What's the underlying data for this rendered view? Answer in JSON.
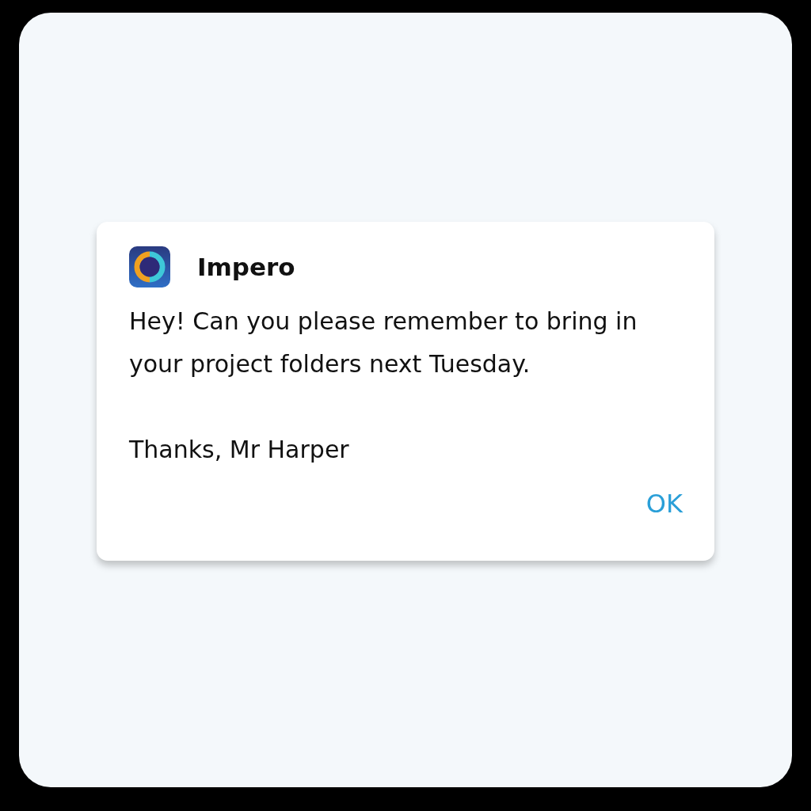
{
  "dialog": {
    "app_name": "Impero",
    "message": "Hey! Can you please remember to bring in your project folders next Tuesday.",
    "signature": "Thanks, Mr Harper",
    "buttons": [
      "OK"
    ]
  }
}
